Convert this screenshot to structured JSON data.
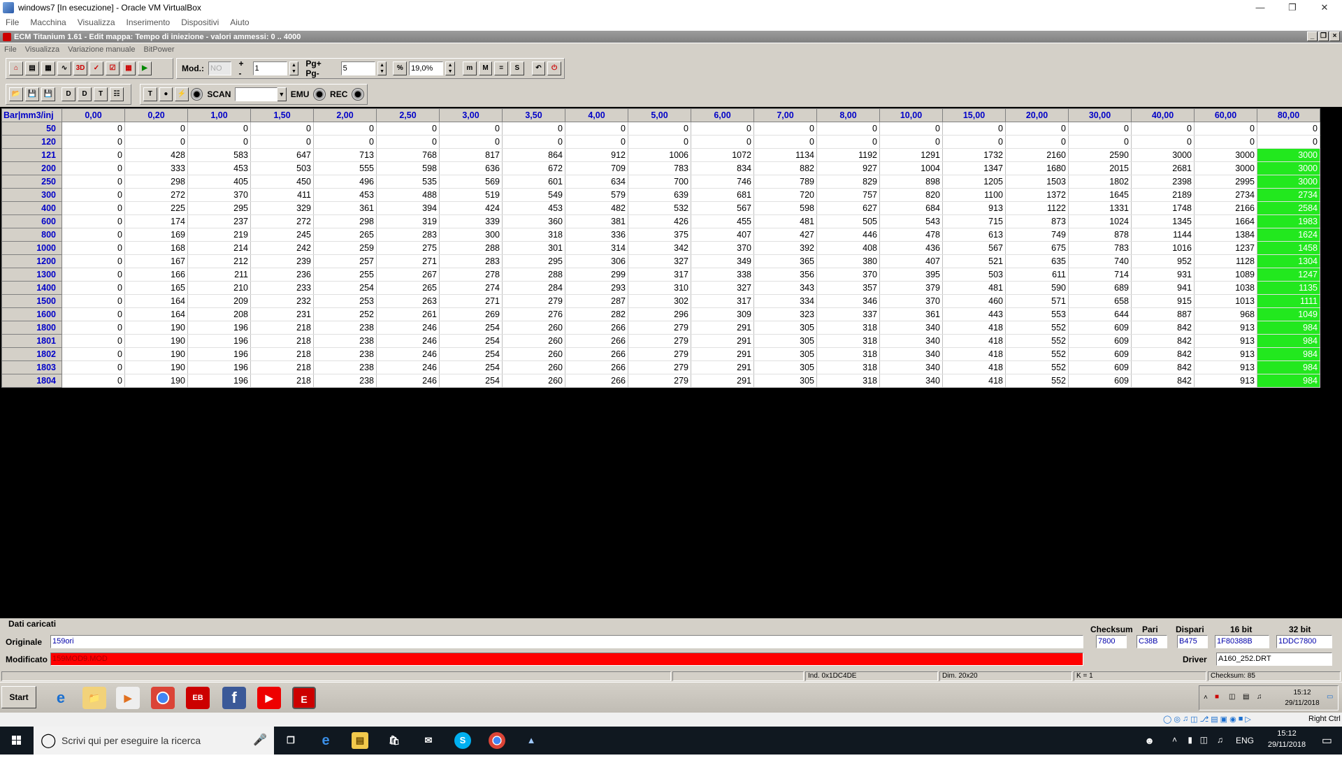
{
  "vbox": {
    "title": "windows7 [In esecuzione] - Oracle VM VirtualBox",
    "menu": [
      "File",
      "Macchina",
      "Visualizza",
      "Inserimento",
      "Dispositivi",
      "Aiuto"
    ],
    "status_right": "Right Ctrl"
  },
  "ecm": {
    "title": "ECM Titanium 1.61 - Edit mappa: Tempo di iniezione - valori ammessi: 0 .. 4000",
    "menu": [
      "File",
      "Visualizza",
      "Variazione manuale",
      "BitPower"
    ]
  },
  "toolbar": {
    "mod_label": "Mod.:",
    "mod_value": "NO",
    "plusminus_label": "+ -",
    "plusminus_value": "1",
    "pg_label": "Pg+ Pg-",
    "pg_value": "5",
    "percent_value": "19,0%",
    "scan_label": "SCAN",
    "emu_label": "EMU",
    "rec_label": "REC",
    "scan_value": ""
  },
  "map": {
    "corner": "Bar|mm3/inj",
    "columns": [
      "0,00",
      "0,20",
      "1,00",
      "1,50",
      "2,00",
      "2,50",
      "3,00",
      "3,50",
      "4,00",
      "5,00",
      "6,00",
      "7,00",
      "8,00",
      "10,00",
      "15,00",
      "20,00",
      "30,00",
      "40,00",
      "60,00",
      "80,00"
    ],
    "rows": [
      {
        "label": "50",
        "values": [
          0,
          0,
          0,
          0,
          0,
          0,
          0,
          0,
          0,
          0,
          0,
          0,
          0,
          0,
          0,
          0,
          0,
          0,
          0,
          0
        ],
        "hl": false
      },
      {
        "label": "120",
        "values": [
          0,
          0,
          0,
          0,
          0,
          0,
          0,
          0,
          0,
          0,
          0,
          0,
          0,
          0,
          0,
          0,
          0,
          0,
          0,
          0
        ],
        "hl": false
      },
      {
        "label": "121",
        "values": [
          0,
          428,
          583,
          647,
          713,
          768,
          817,
          864,
          912,
          1006,
          1072,
          1134,
          1192,
          1291,
          1732,
          2160,
          2590,
          3000,
          3000,
          3000
        ],
        "hl": true
      },
      {
        "label": "200",
        "values": [
          0,
          333,
          453,
          503,
          555,
          598,
          636,
          672,
          709,
          783,
          834,
          882,
          927,
          1004,
          1347,
          1680,
          2015,
          2681,
          3000,
          3000
        ],
        "hl": true
      },
      {
        "label": "250",
        "values": [
          0,
          298,
          405,
          450,
          496,
          535,
          569,
          601,
          634,
          700,
          746,
          789,
          829,
          898,
          1205,
          1503,
          1802,
          2398,
          2995,
          3000
        ],
        "hl": true
      },
      {
        "label": "300",
        "values": [
          0,
          272,
          370,
          411,
          453,
          488,
          519,
          549,
          579,
          639,
          681,
          720,
          757,
          820,
          1100,
          1372,
          1645,
          2189,
          2734,
          2734
        ],
        "hl": true
      },
      {
        "label": "400",
        "values": [
          0,
          225,
          295,
          329,
          361,
          394,
          424,
          453,
          482,
          532,
          567,
          598,
          627,
          684,
          913,
          1122,
          1331,
          1748,
          2166,
          2584
        ],
        "hl": true
      },
      {
        "label": "600",
        "values": [
          0,
          174,
          237,
          272,
          298,
          319,
          339,
          360,
          381,
          426,
          455,
          481,
          505,
          543,
          715,
          873,
          1024,
          1345,
          1664,
          1983
        ],
        "hl": true
      },
      {
        "label": "800",
        "values": [
          0,
          169,
          219,
          245,
          265,
          283,
          300,
          318,
          336,
          375,
          407,
          427,
          446,
          478,
          613,
          749,
          878,
          1144,
          1384,
          1624
        ],
        "hl": true
      },
      {
        "label": "1000",
        "values": [
          0,
          168,
          214,
          242,
          259,
          275,
          288,
          301,
          314,
          342,
          370,
          392,
          408,
          436,
          567,
          675,
          783,
          1016,
          1237,
          1458
        ],
        "hl": true
      },
      {
        "label": "1200",
        "values": [
          0,
          167,
          212,
          239,
          257,
          271,
          283,
          295,
          306,
          327,
          349,
          365,
          380,
          407,
          521,
          635,
          740,
          952,
          1128,
          1304
        ],
        "hl": true
      },
      {
        "label": "1300",
        "values": [
          0,
          166,
          211,
          236,
          255,
          267,
          278,
          288,
          299,
          317,
          338,
          356,
          370,
          395,
          503,
          611,
          714,
          931,
          1089,
          1247
        ],
        "hl": true
      },
      {
        "label": "1400",
        "values": [
          0,
          165,
          210,
          233,
          254,
          265,
          274,
          284,
          293,
          310,
          327,
          343,
          357,
          379,
          481,
          590,
          689,
          941,
          1038,
          1135
        ],
        "hl": true
      },
      {
        "label": "1500",
        "values": [
          0,
          164,
          209,
          232,
          253,
          263,
          271,
          279,
          287,
          302,
          317,
          334,
          346,
          370,
          460,
          571,
          658,
          915,
          1013,
          1111
        ],
        "hl": true
      },
      {
        "label": "1600",
        "values": [
          0,
          164,
          208,
          231,
          252,
          261,
          269,
          276,
          282,
          296,
          309,
          323,
          337,
          361,
          443,
          553,
          644,
          887,
          968,
          1049
        ],
        "hl": true
      },
      {
        "label": "1800",
        "values": [
          0,
          190,
          196,
          218,
          238,
          246,
          254,
          260,
          266,
          279,
          291,
          305,
          318,
          340,
          418,
          552,
          609,
          842,
          913,
          984
        ],
        "hl": true
      },
      {
        "label": "1801",
        "values": [
          0,
          190,
          196,
          218,
          238,
          246,
          254,
          260,
          266,
          279,
          291,
          305,
          318,
          340,
          418,
          552,
          609,
          842,
          913,
          984
        ],
        "hl": true
      },
      {
        "label": "1802",
        "values": [
          0,
          190,
          196,
          218,
          238,
          246,
          254,
          260,
          266,
          279,
          291,
          305,
          318,
          340,
          418,
          552,
          609,
          842,
          913,
          984
        ],
        "hl": true
      },
      {
        "label": "1803",
        "values": [
          0,
          190,
          196,
          218,
          238,
          246,
          254,
          260,
          266,
          279,
          291,
          305,
          318,
          340,
          418,
          552,
          609,
          842,
          913,
          984
        ],
        "hl": true
      },
      {
        "label": "1804",
        "values": [
          0,
          190,
          196,
          218,
          238,
          246,
          254,
          260,
          266,
          279,
          291,
          305,
          318,
          340,
          418,
          552,
          609,
          842,
          913,
          984
        ],
        "hl": true
      }
    ],
    "highlight_color": "#22e81e"
  },
  "panel": {
    "group_label": "Dati caricati",
    "originale_label": "Originale",
    "originale_value": "159ori",
    "modificato_label": "Modificato",
    "modificato_value": "159MOD9.MOD",
    "modificato_color": "#ff0000",
    "checksum_label": "Checksum",
    "checksum_value": "7800",
    "pari_label": "Pari",
    "pari_value": "C38B",
    "dispari_label": "Dispari",
    "dispari_value": "B475",
    "bit16_label": "16 bit",
    "bit16_value": "1F80388B",
    "bit32_label": "32 bit",
    "bit32_value": "1DDC7800",
    "driver_label": "Driver",
    "driver_value": "A160_252.DRT"
  },
  "statusbar": {
    "ind": "Ind. 0x1DC4DE",
    "dim": "Dim. 20x20",
    "k": "K = 1",
    "checksum": "Checksum: 85"
  },
  "guest_taskbar": {
    "start": "Start",
    "time": "15:12",
    "date": "29/11/2018"
  },
  "host_taskbar": {
    "search_placeholder": "Scrivi qui per eseguire la ricerca",
    "lang": "ENG",
    "time": "15:12",
    "date": "29/11/2018"
  }
}
